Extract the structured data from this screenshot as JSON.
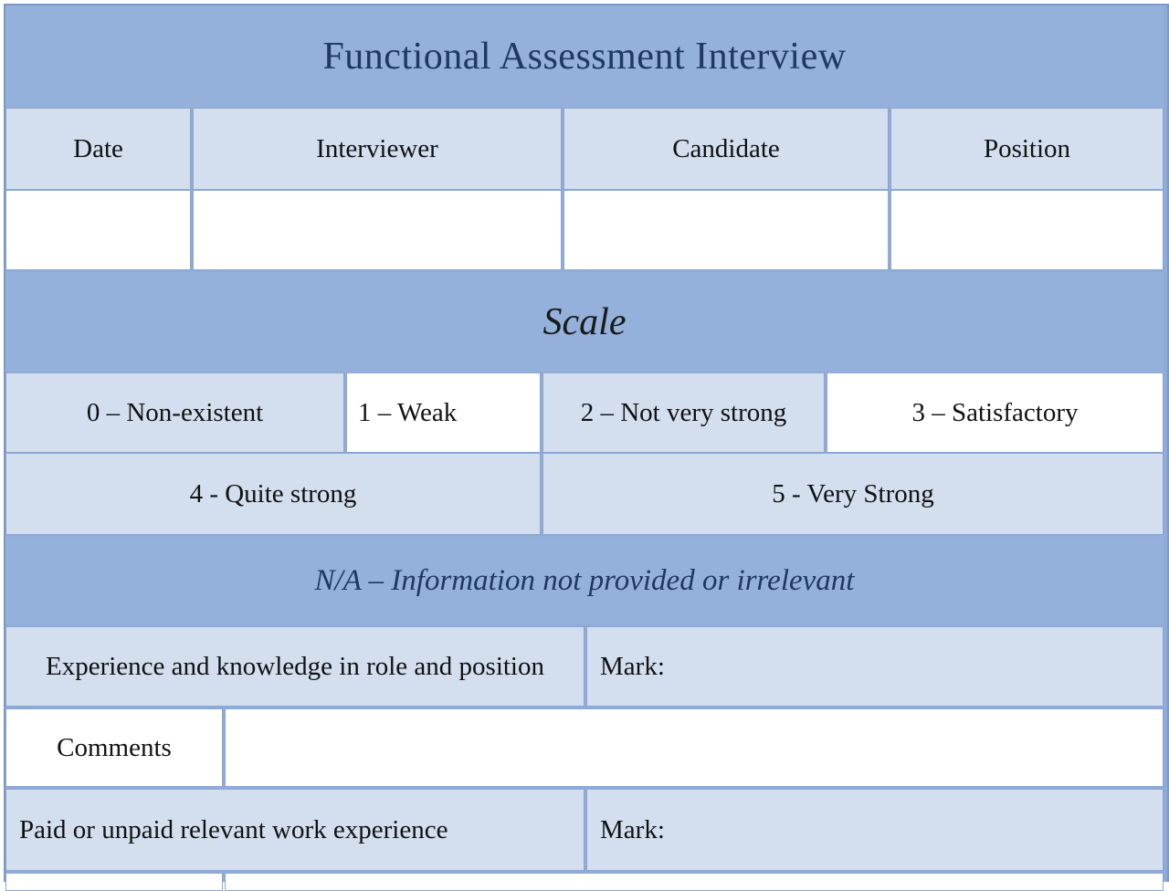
{
  "form": {
    "title": "Functional Assessment Interview",
    "header_fields": [
      {
        "label": "Date",
        "value": ""
      },
      {
        "label": "Interviewer",
        "value": ""
      },
      {
        "label": "Candidate",
        "value": ""
      },
      {
        "label": "Position",
        "value": ""
      }
    ],
    "scale": {
      "heading": "Scale",
      "levels": [
        "0 – Non-existent",
        "1 – Weak",
        "2 – Not very strong",
        "3 – Satisfactory",
        "4 - Quite strong",
        "5 - Very Strong"
      ],
      "na_note": "N/A – Information not provided or irrelevant"
    },
    "criteria": [
      {
        "label": "Experience and knowledge in role and position",
        "mark_label": "Mark:",
        "mark_value": "",
        "comments_label": "Comments",
        "comments_value": ""
      },
      {
        "label": "Paid or unpaid relevant work experience",
        "mark_label": "Mark:",
        "mark_value": ""
      }
    ]
  },
  "colors": {
    "band": "#93b1da",
    "light_cell": "#d3deee",
    "border": "#8ca6d2",
    "title_text": "#1f3864"
  }
}
